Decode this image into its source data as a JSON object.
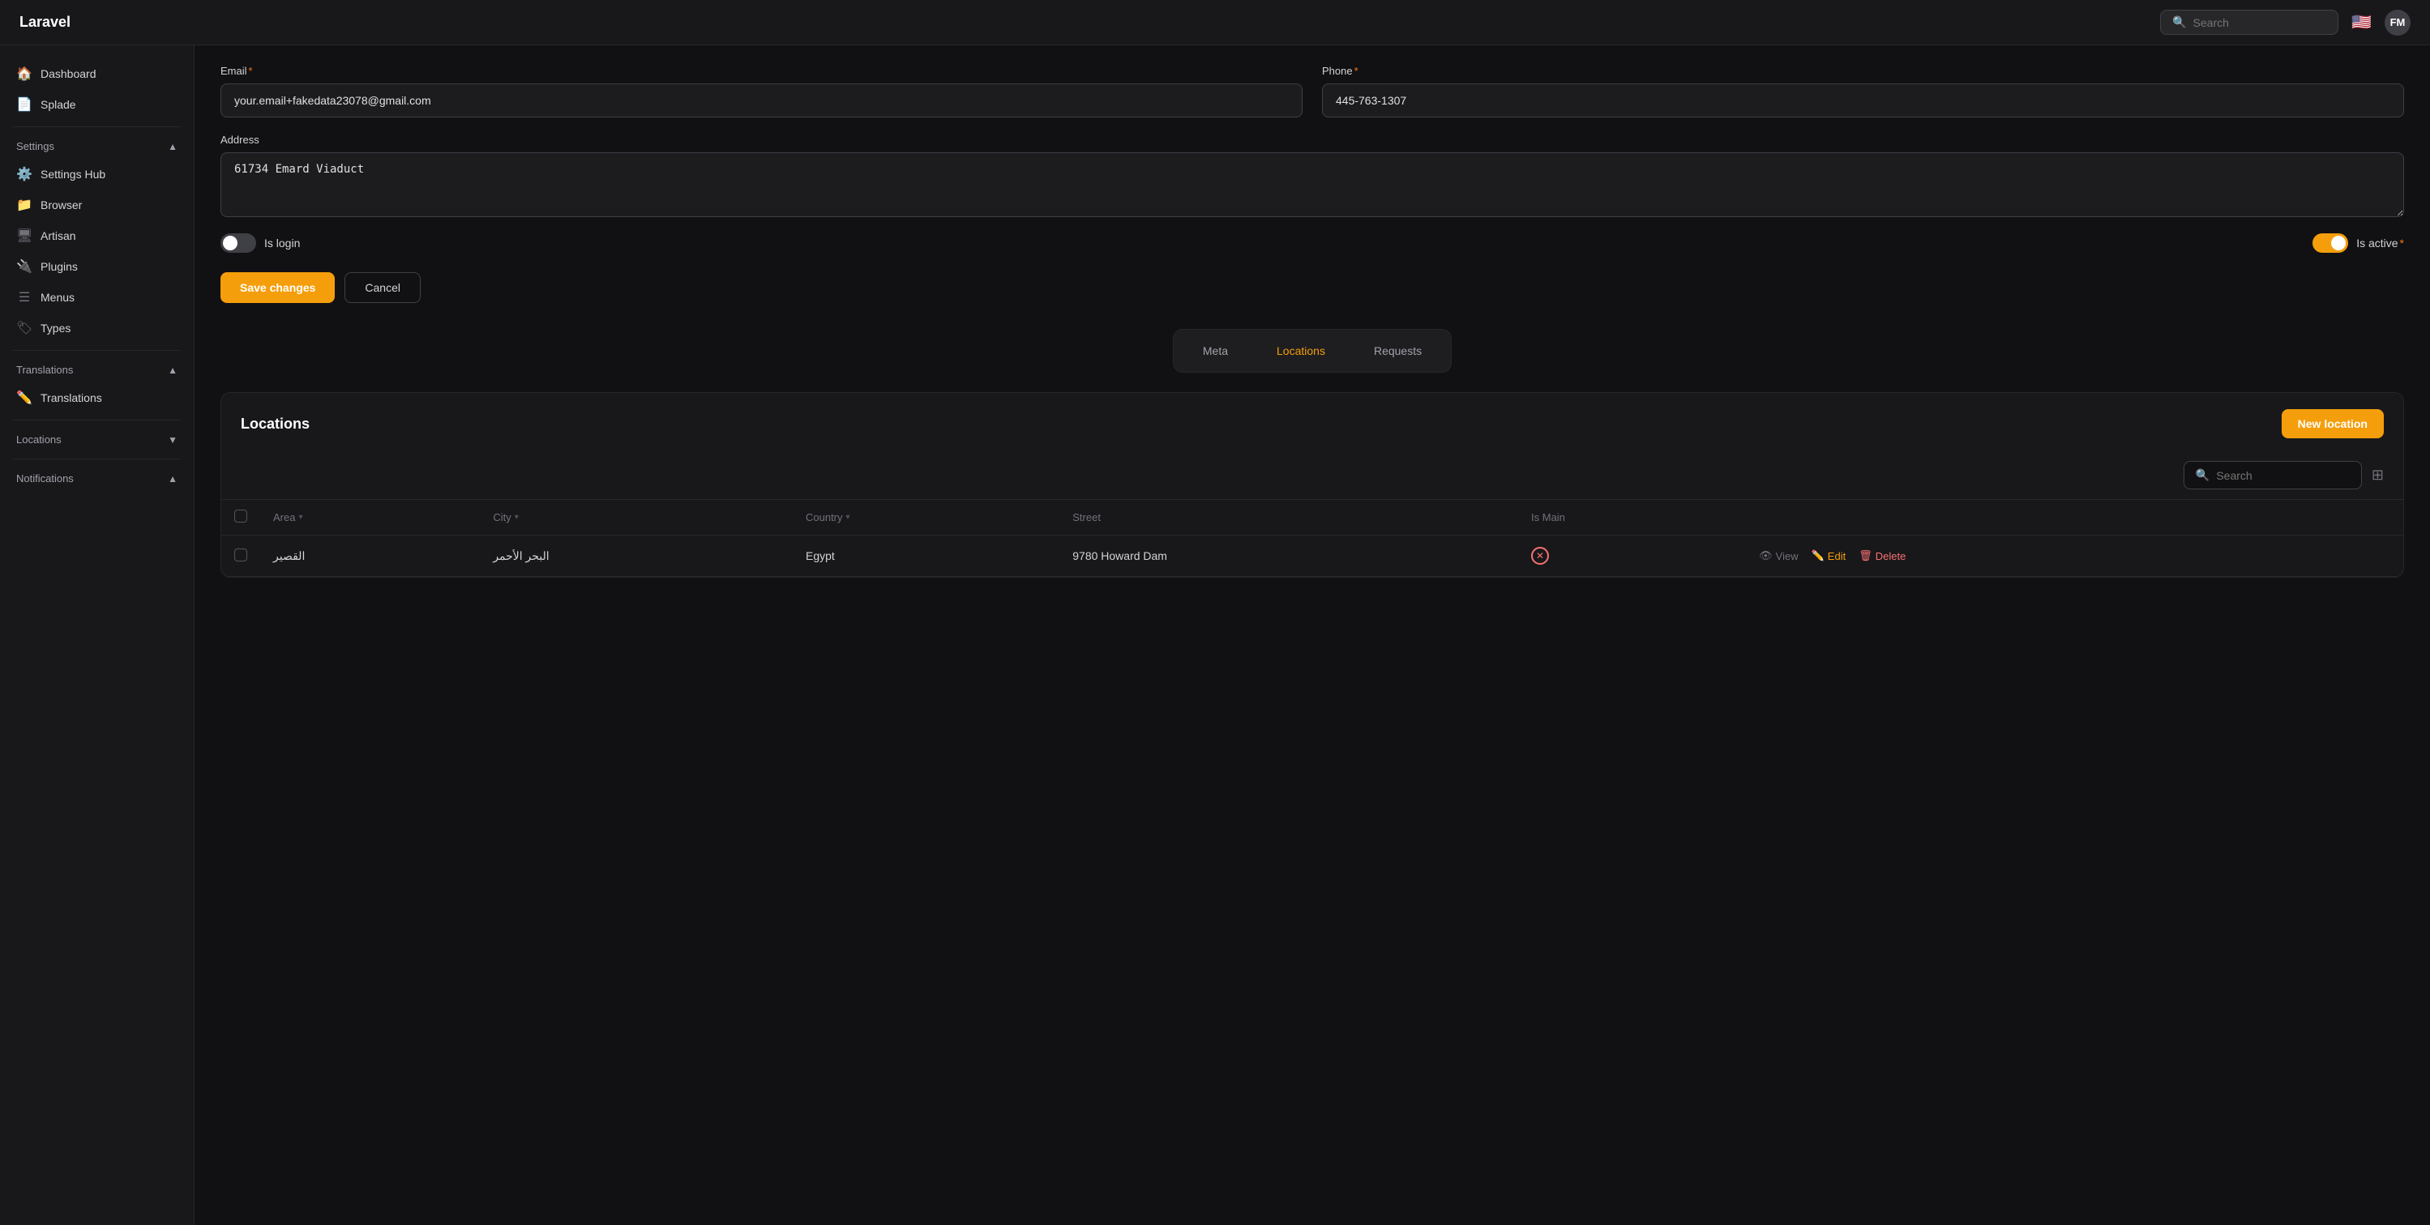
{
  "app": {
    "name": "Laravel"
  },
  "topnav": {
    "search_placeholder": "Search",
    "user_initials": "FM"
  },
  "sidebar": {
    "main_items": [
      {
        "id": "dashboard",
        "label": "Dashboard",
        "icon": "🏠"
      },
      {
        "id": "splade",
        "label": "Splade",
        "icon": "📄"
      }
    ],
    "settings": {
      "label": "Settings",
      "items": [
        {
          "id": "settings-hub",
          "label": "Settings Hub",
          "icon": "⚙️"
        },
        {
          "id": "browser",
          "label": "Browser",
          "icon": "📁"
        },
        {
          "id": "artisan",
          "label": "Artisan",
          "icon": "🖥"
        },
        {
          "id": "plugins",
          "label": "Plugins",
          "icon": "🔌"
        },
        {
          "id": "menus",
          "label": "Menus",
          "icon": "☰"
        },
        {
          "id": "types",
          "label": "Types",
          "icon": "🏷"
        }
      ]
    },
    "translations": {
      "label": "Translations",
      "items": [
        {
          "id": "translations",
          "label": "Translations",
          "icon": "✏️"
        }
      ]
    },
    "locations": {
      "label": "Locations",
      "items": []
    },
    "notifications": {
      "label": "Notifications",
      "items": []
    }
  },
  "form": {
    "email_label": "Email",
    "email_required": true,
    "email_value": "your.email+fakedata23078@gmail.com",
    "phone_label": "Phone",
    "phone_required": true,
    "phone_value": "445-763-1307",
    "address_label": "Address",
    "address_value": "61734 Emard Viaduct",
    "is_login_label": "Is login",
    "is_login_active": false,
    "is_active_label": "Is active",
    "is_active_required": true,
    "is_active_active": true,
    "save_button": "Save changes",
    "cancel_button": "Cancel"
  },
  "tabs": {
    "items": [
      {
        "id": "meta",
        "label": "Meta",
        "active": false
      },
      {
        "id": "locations",
        "label": "Locations",
        "active": true
      },
      {
        "id": "requests",
        "label": "Requests",
        "active": false
      }
    ]
  },
  "locations_section": {
    "title": "Locations",
    "new_button": "New location",
    "search_placeholder": "Search",
    "columns": [
      {
        "id": "area",
        "label": "Area",
        "sortable": true
      },
      {
        "id": "city",
        "label": "City",
        "sortable": true
      },
      {
        "id": "country",
        "label": "Country",
        "sortable": true
      },
      {
        "id": "street",
        "label": "Street",
        "sortable": false
      },
      {
        "id": "is_main",
        "label": "Is Main",
        "sortable": false
      }
    ],
    "rows": [
      {
        "area": "القصير",
        "city": "البحر الأحمر",
        "country": "Egypt",
        "street": "9780 Howard Dam",
        "is_main": false,
        "actions": [
          "View",
          "Edit",
          "Delete"
        ]
      }
    ]
  }
}
